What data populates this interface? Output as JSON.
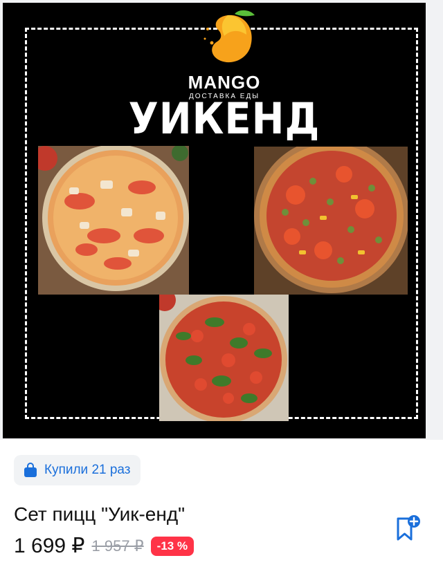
{
  "poster": {
    "brand": "MANGO",
    "brand_subtitle": "ДОСТАВКА ЕДЫ",
    "headline": "УИКЕНД"
  },
  "purchases_badge": {
    "icon": "shopping-bag-icon",
    "text": "Купили 21 раз"
  },
  "product": {
    "title": "Сет пицц \"Уик-енд\"",
    "price": "1 699 ₽",
    "old_price": "1 957 ₽",
    "discount": "-13 %"
  },
  "favorite": {
    "icon": "bookmark-add-icon"
  },
  "colors": {
    "accent_blue": "#1a6fdb",
    "discount_red": "#ff3347",
    "poster_bg": "#000000",
    "logo_orange": "#f7a21b"
  }
}
